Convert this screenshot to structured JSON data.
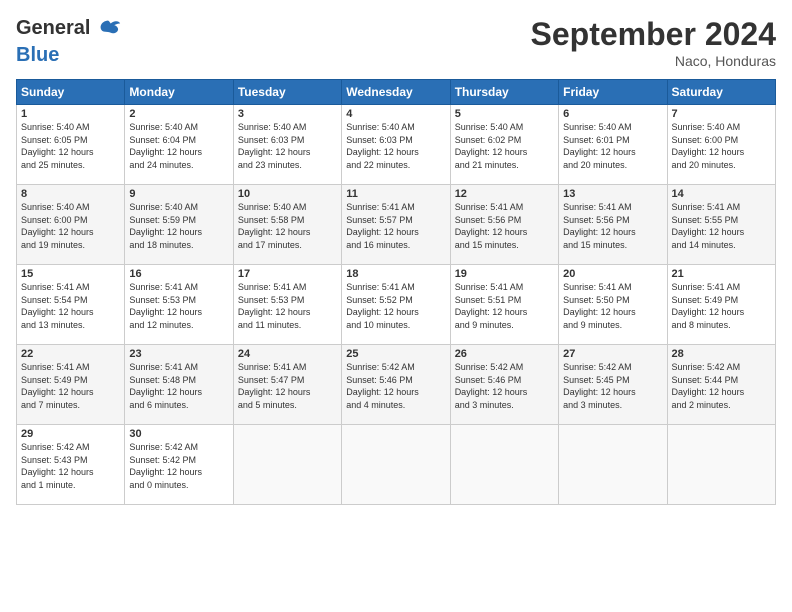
{
  "logo": {
    "general": "General",
    "blue": "Blue"
  },
  "title": "September 2024",
  "location": "Naco, Honduras",
  "days_of_week": [
    "Sunday",
    "Monday",
    "Tuesday",
    "Wednesday",
    "Thursday",
    "Friday",
    "Saturday"
  ],
  "weeks": [
    [
      {
        "day": "1",
        "sunrise": "5:40 AM",
        "sunset": "6:05 PM",
        "daylight": "12 hours and 25 minutes."
      },
      {
        "day": "2",
        "sunrise": "5:40 AM",
        "sunset": "6:04 PM",
        "daylight": "12 hours and 24 minutes."
      },
      {
        "day": "3",
        "sunrise": "5:40 AM",
        "sunset": "6:03 PM",
        "daylight": "12 hours and 23 minutes."
      },
      {
        "day": "4",
        "sunrise": "5:40 AM",
        "sunset": "6:03 PM",
        "daylight": "12 hours and 22 minutes."
      },
      {
        "day": "5",
        "sunrise": "5:40 AM",
        "sunset": "6:02 PM",
        "daylight": "12 hours and 21 minutes."
      },
      {
        "day": "6",
        "sunrise": "5:40 AM",
        "sunset": "6:01 PM",
        "daylight": "12 hours and 20 minutes."
      },
      {
        "day": "7",
        "sunrise": "5:40 AM",
        "sunset": "6:00 PM",
        "daylight": "12 hours and 20 minutes."
      }
    ],
    [
      {
        "day": "8",
        "sunrise": "5:40 AM",
        "sunset": "6:00 PM",
        "daylight": "12 hours and 19 minutes."
      },
      {
        "day": "9",
        "sunrise": "5:40 AM",
        "sunset": "5:59 PM",
        "daylight": "12 hours and 18 minutes."
      },
      {
        "day": "10",
        "sunrise": "5:40 AM",
        "sunset": "5:58 PM",
        "daylight": "12 hours and 17 minutes."
      },
      {
        "day": "11",
        "sunrise": "5:41 AM",
        "sunset": "5:57 PM",
        "daylight": "12 hours and 16 minutes."
      },
      {
        "day": "12",
        "sunrise": "5:41 AM",
        "sunset": "5:56 PM",
        "daylight": "12 hours and 15 minutes."
      },
      {
        "day": "13",
        "sunrise": "5:41 AM",
        "sunset": "5:56 PM",
        "daylight": "12 hours and 15 minutes."
      },
      {
        "day": "14",
        "sunrise": "5:41 AM",
        "sunset": "5:55 PM",
        "daylight": "12 hours and 14 minutes."
      }
    ],
    [
      {
        "day": "15",
        "sunrise": "5:41 AM",
        "sunset": "5:54 PM",
        "daylight": "12 hours and 13 minutes."
      },
      {
        "day": "16",
        "sunrise": "5:41 AM",
        "sunset": "5:53 PM",
        "daylight": "12 hours and 12 minutes."
      },
      {
        "day": "17",
        "sunrise": "5:41 AM",
        "sunset": "5:53 PM",
        "daylight": "12 hours and 11 minutes."
      },
      {
        "day": "18",
        "sunrise": "5:41 AM",
        "sunset": "5:52 PM",
        "daylight": "12 hours and 10 minutes."
      },
      {
        "day": "19",
        "sunrise": "5:41 AM",
        "sunset": "5:51 PM",
        "daylight": "12 hours and 9 minutes."
      },
      {
        "day": "20",
        "sunrise": "5:41 AM",
        "sunset": "5:50 PM",
        "daylight": "12 hours and 9 minutes."
      },
      {
        "day": "21",
        "sunrise": "5:41 AM",
        "sunset": "5:49 PM",
        "daylight": "12 hours and 8 minutes."
      }
    ],
    [
      {
        "day": "22",
        "sunrise": "5:41 AM",
        "sunset": "5:49 PM",
        "daylight": "12 hours and 7 minutes."
      },
      {
        "day": "23",
        "sunrise": "5:41 AM",
        "sunset": "5:48 PM",
        "daylight": "12 hours and 6 minutes."
      },
      {
        "day": "24",
        "sunrise": "5:41 AM",
        "sunset": "5:47 PM",
        "daylight": "12 hours and 5 minutes."
      },
      {
        "day": "25",
        "sunrise": "5:42 AM",
        "sunset": "5:46 PM",
        "daylight": "12 hours and 4 minutes."
      },
      {
        "day": "26",
        "sunrise": "5:42 AM",
        "sunset": "5:46 PM",
        "daylight": "12 hours and 3 minutes."
      },
      {
        "day": "27",
        "sunrise": "5:42 AM",
        "sunset": "5:45 PM",
        "daylight": "12 hours and 3 minutes."
      },
      {
        "day": "28",
        "sunrise": "5:42 AM",
        "sunset": "5:44 PM",
        "daylight": "12 hours and 2 minutes."
      }
    ],
    [
      {
        "day": "29",
        "sunrise": "5:42 AM",
        "sunset": "5:43 PM",
        "daylight": "12 hours and 1 minute."
      },
      {
        "day": "30",
        "sunrise": "5:42 AM",
        "sunset": "5:42 PM",
        "daylight": "12 hours and 0 minutes."
      },
      null,
      null,
      null,
      null,
      null
    ]
  ],
  "labels": {
    "sunrise": "Sunrise:",
    "sunset": "Sunset:",
    "daylight": "Daylight:"
  }
}
